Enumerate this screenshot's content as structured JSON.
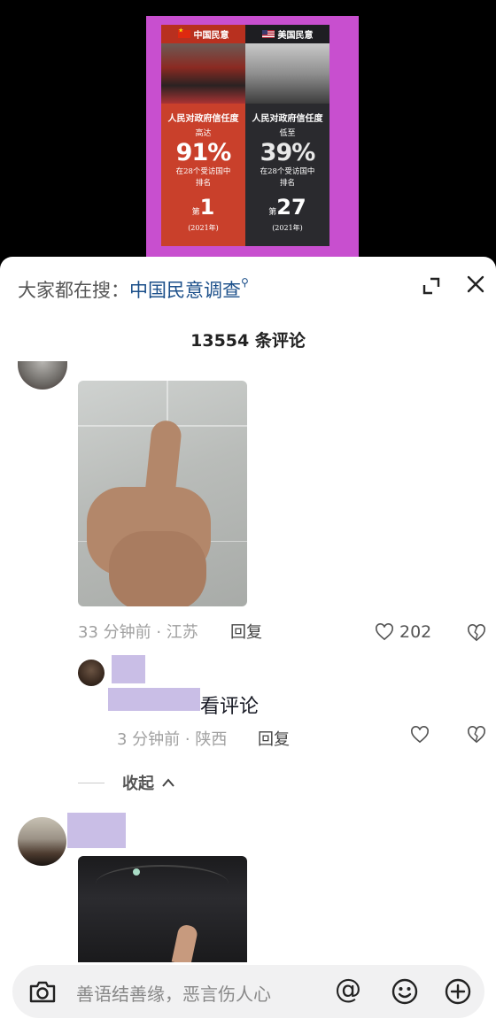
{
  "poster": {
    "left_header": "中国民意",
    "right_header": "美国民意",
    "left_title": "人民对政府信任度",
    "left_sub": "高达",
    "left_percent": "91%",
    "left_line1": "在28个受访国中",
    "left_line2": "排名",
    "left_rank_prefix": "第",
    "left_rank": "1",
    "left_year": "(2021年)",
    "right_title": "人民对政府信任度",
    "right_sub": "低至",
    "right_percent": "39%",
    "right_line1": "在28个受访国中",
    "right_line2": "排名",
    "right_rank_prefix": "第",
    "right_rank": "27",
    "right_year": "(2021年)"
  },
  "sheet": {
    "search_prefix": "大家都在搜：",
    "search_keyword": "中国民意调查",
    "comment_count": "13554 条评论"
  },
  "comments": [
    {
      "time_location": "33 分钟前 · 江苏",
      "reply_label": "回复",
      "like_count": "202"
    }
  ],
  "sub_comment": {
    "text": "看评论",
    "time_location": "3 分钟前 · 陕西",
    "reply_label": "回复"
  },
  "collapse_label": "收起",
  "input": {
    "placeholder": "善语结善缘，恶言伤人心",
    "at_symbol": "@"
  },
  "icons": {
    "expand": "expand-icon",
    "close": "close-icon",
    "like": "heart-icon",
    "dislike": "dislike-icon",
    "camera": "camera-icon",
    "emoji": "emoji-icon",
    "plus": "plus-icon"
  },
  "colors": {
    "search_keyword": "#1b4f8a",
    "poster_background": "#c84fcf",
    "name_mask": "#c9bee6"
  }
}
